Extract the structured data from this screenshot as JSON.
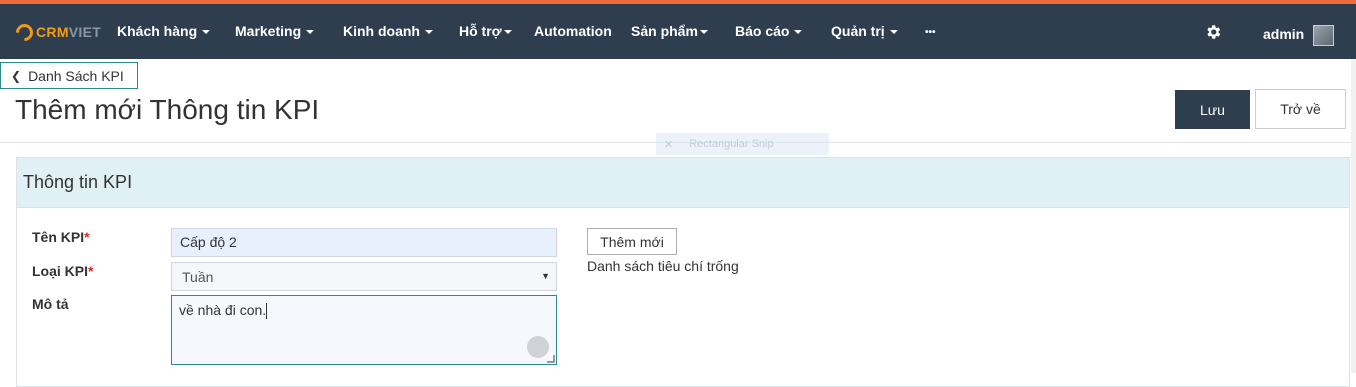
{
  "brand": {
    "name_primary": "CRM",
    "name_secondary": "VIET",
    "accent": "#f39c12",
    "bar_top_color": "#f36a3f",
    "nav_bg": "#2e3e4f"
  },
  "nav": {
    "items": [
      {
        "label": "Khách hàng",
        "has_caret": true
      },
      {
        "label": "Marketing",
        "has_caret": true
      },
      {
        "label": "Kinh doanh",
        "has_caret": true
      },
      {
        "label": "Hỗ trợ",
        "has_caret": true
      },
      {
        "label": "Automation",
        "has_caret": false
      },
      {
        "label": "Sản phẩm",
        "has_caret": true
      },
      {
        "label": "Báo cáo",
        "has_caret": true
      },
      {
        "label": "Quản trị",
        "has_caret": true
      },
      {
        "label": "•••",
        "has_caret": false
      }
    ],
    "settings_icon": "gear-icon",
    "user": "admin"
  },
  "breadcrumb": {
    "back_label": "Danh Sách KPI"
  },
  "page": {
    "title": "Thêm mới Thông tin KPI"
  },
  "actions": {
    "save_label": "Lưu",
    "back_label": "Trở về"
  },
  "overlay": {
    "snip_label": "Rectangular Snip"
  },
  "panel": {
    "heading": "Thông tin KPI",
    "fields": {
      "name_label": "Tên KPI",
      "name_value": "Cấp độ 2",
      "type_label": "Loại KPI",
      "type_value": "Tuần",
      "desc_label": "Mô tả",
      "desc_value": "về nhà đi con."
    },
    "required_mark": "*",
    "add_button": "Thêm mới",
    "criteria_empty": "Danh sách tiêu chí trống"
  }
}
